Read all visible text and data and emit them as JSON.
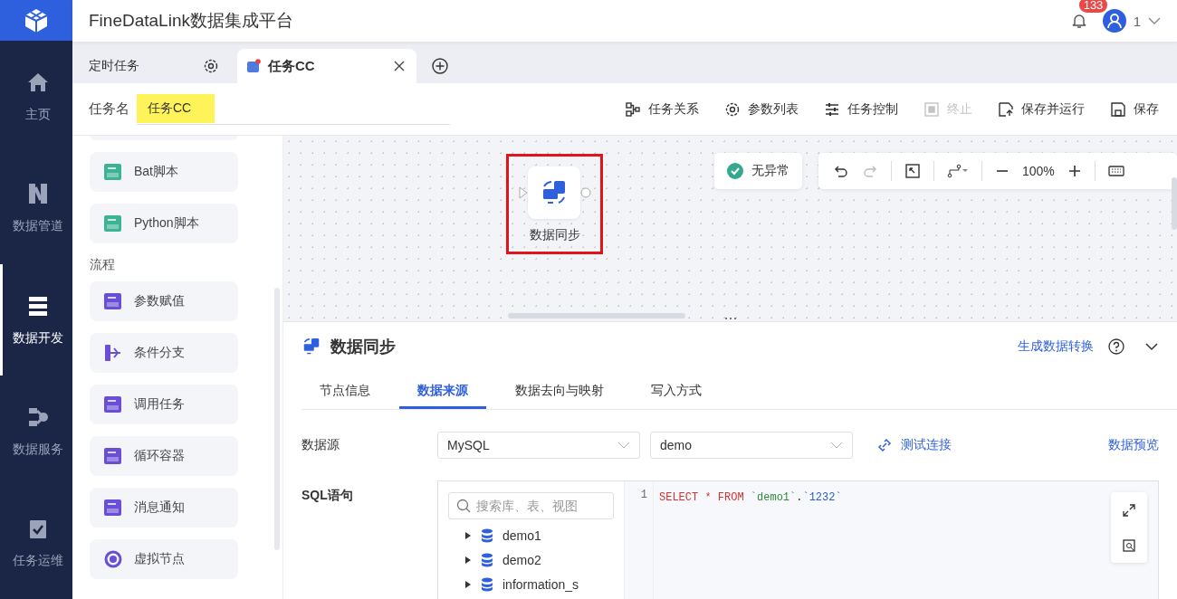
{
  "header": {
    "title": "FineDataLink数据集成平台",
    "notification_count": "133",
    "user": "1"
  },
  "nav": [
    {
      "label": "主页",
      "selected": false
    },
    {
      "label": "数据管道",
      "selected": false
    },
    {
      "label": "数据开发",
      "selected": true
    },
    {
      "label": "数据服务",
      "selected": false
    },
    {
      "label": "任务运维",
      "selected": false
    }
  ],
  "tabs": [
    {
      "label": "定时任务",
      "selected": false,
      "kind": "settings"
    },
    {
      "label": "任务CC",
      "selected": true,
      "kind": "task"
    }
  ],
  "task_name": {
    "label": "任务名",
    "value": "任务CC"
  },
  "actions": [
    {
      "label": "任务关系",
      "disabled": false
    },
    {
      "label": "参数列表",
      "disabled": false
    },
    {
      "label": "任务控制",
      "disabled": false
    },
    {
      "label": "终止",
      "disabled": true
    },
    {
      "label": "保存并运行",
      "disabled": false
    },
    {
      "label": "保存",
      "disabled": false
    }
  ],
  "palette": [
    {
      "kind": "item",
      "label": "Bat脚本"
    },
    {
      "kind": "item",
      "label": "Python脚本"
    },
    {
      "kind": "section",
      "label": "流程"
    },
    {
      "kind": "item",
      "label": "参数赋值"
    },
    {
      "kind": "item",
      "label": "条件分支"
    },
    {
      "kind": "item",
      "label": "调用任务"
    },
    {
      "kind": "item",
      "label": "循环容器"
    },
    {
      "kind": "item",
      "label": "消息通知"
    },
    {
      "kind": "item",
      "label": "虚拟节点"
    }
  ],
  "canvas": {
    "node": {
      "label": "数据同步"
    },
    "status": "无异常",
    "zoom": "100%"
  },
  "panel": {
    "title": "数据同步",
    "link": "生成数据转换",
    "tabs": [
      {
        "label": "节点信息",
        "selected": false
      },
      {
        "label": "数据来源",
        "selected": true
      },
      {
        "label": "数据去向与映射",
        "selected": false
      },
      {
        "label": "写入方式",
        "selected": false
      }
    ],
    "source_label": "数据源",
    "source_type": "MySQL",
    "source_db": "demo",
    "test_link": "测试连接",
    "preview_link": "数据预览",
    "sql_label": "SQL语句",
    "search_placeholder": "搜索库、表、视图",
    "tree": [
      {
        "label": "demo1",
        "expanded": false
      },
      {
        "label": "demo2",
        "expanded": false
      },
      {
        "label": "information_s",
        "expanded": false
      }
    ],
    "code": {
      "line": "1",
      "tokens": [
        {
          "kind": "keyword",
          "text": "SELECT * FROM "
        },
        {
          "kind": "string",
          "text": "`demo1`"
        },
        {
          "kind": "plain",
          "text": "."
        },
        {
          "kind": "number",
          "text": "`1232`"
        }
      ]
    }
  }
}
